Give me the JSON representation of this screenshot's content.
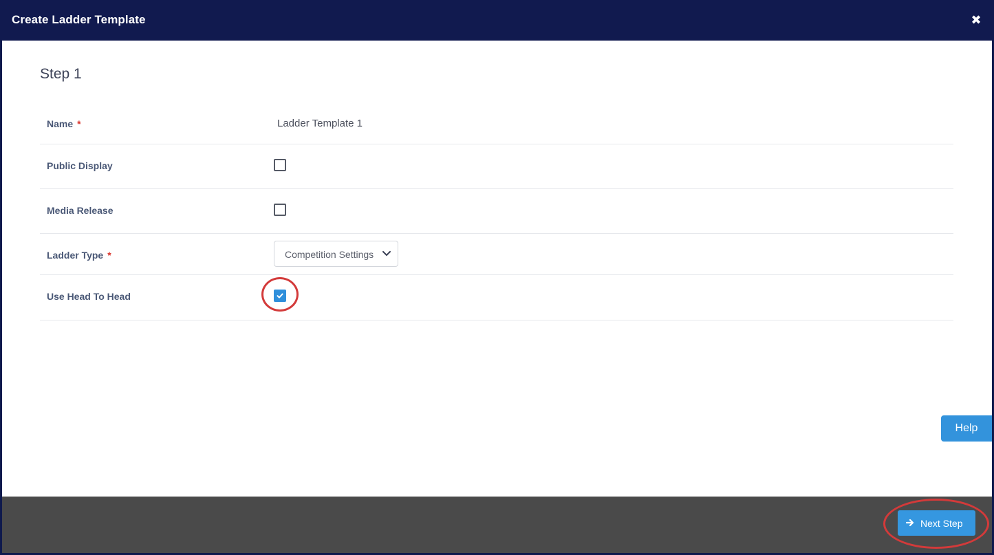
{
  "modal": {
    "title": "Create Ladder Template",
    "close_icon": "close-icon"
  },
  "step": {
    "title": "Step 1"
  },
  "form": {
    "name": {
      "label": "Name",
      "required_mark": "*",
      "value": "Ladder Template 1"
    },
    "public_display": {
      "label": "Public Display",
      "checked": false
    },
    "media_release": {
      "label": "Media Release",
      "checked": false
    },
    "ladder_type": {
      "label": "Ladder Type",
      "required_mark": "*",
      "selected": "Competition Settings"
    },
    "use_head_to_head": {
      "label": "Use Head To Head",
      "checked": true
    }
  },
  "help": {
    "label": "Help"
  },
  "footer": {
    "next_label": "Next Step"
  },
  "colors": {
    "header_bg": "#111a4f",
    "accent": "#3393dc",
    "footer_bg": "#4a4a4a",
    "annotation": "#d33a3a",
    "required": "#d9342b"
  }
}
